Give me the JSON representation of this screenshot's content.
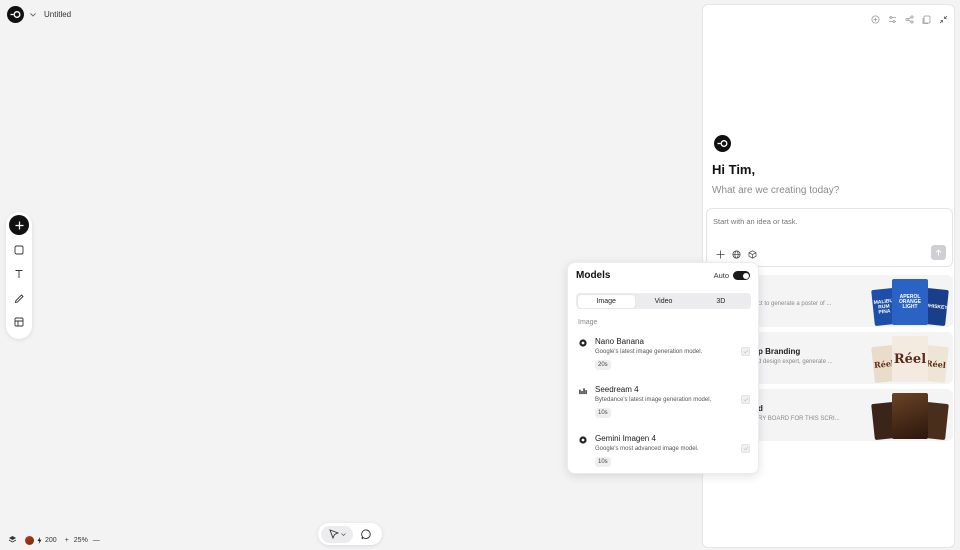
{
  "header": {
    "title": "Untitled"
  },
  "left_toolbar": {
    "tools": [
      {
        "name": "add-tool",
        "icon": "plus-icon"
      },
      {
        "name": "frame-tool",
        "icon": "square-icon"
      },
      {
        "name": "text-tool",
        "icon": "text-icon"
      },
      {
        "name": "pencil-tool",
        "icon": "pencil-icon"
      },
      {
        "name": "layout-tool",
        "icon": "layout-icon"
      }
    ]
  },
  "bottom_bar": {
    "credits": "200",
    "zoom": "25%"
  },
  "assistant": {
    "greeting": "Hi Tim,",
    "subtitle": "What are we creating today?",
    "prompt_placeholder": "Start with an idea or task.",
    "cards": [
      {
        "title": "",
        "desc": "ct to generate a poster of ...",
        "thumbs": [
          "MALIBU RUM PINA",
          "APEROL ORANGE LIGHT",
          "WHISKEY"
        ]
      },
      {
        "title": "p Branding",
        "desc": "d design expert, generate ...",
        "thumbs": [
          "Réel",
          "Réel",
          "Réel"
        ]
      },
      {
        "title": "d",
        "desc": "RY BOARD FOR THIS SCRI...",
        "thumbs": [
          "",
          "",
          ""
        ]
      }
    ]
  },
  "models_popup": {
    "title": "Models",
    "auto_label": "Auto",
    "auto_enabled": true,
    "tabs": [
      "Image",
      "Video",
      "3D"
    ],
    "active_tab": "Image",
    "section_label": "Image",
    "items": [
      {
        "name": "Nano Banana",
        "desc": "Google's latest image generation model.",
        "time": "20s",
        "icon": "google-gemini-icon"
      },
      {
        "name": "Seedream 4",
        "desc": "Bytedance's latest image generation model.",
        "time": "10s",
        "icon": "bytedance-icon"
      },
      {
        "name": "Gemini Imagen 4",
        "desc": "Google's most advanced image model.",
        "time": "10s",
        "icon": "google-gemini-icon"
      }
    ]
  },
  "colors": {
    "canvas": "#f3f3f4",
    "accent": "#111111",
    "muted_text": "#8a8a8e"
  }
}
